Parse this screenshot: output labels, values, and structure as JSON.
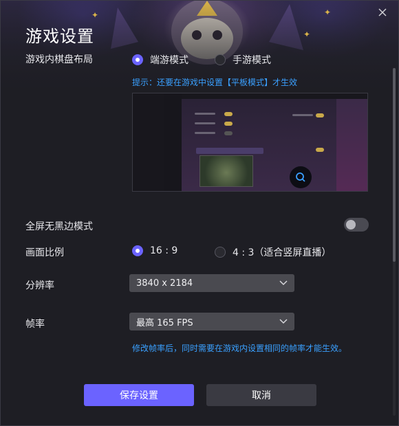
{
  "dialog": {
    "title": "游戏设置"
  },
  "layout": {
    "label": "游戏内棋盘布局",
    "option_pc": "端游模式",
    "option_mobile": "手游模式",
    "selected": "端游模式",
    "hint": "提示：还要在游戏中设置【平板模式】才生效"
  },
  "fullscreen": {
    "label": "全屏无黑边模式",
    "enabled": false
  },
  "ratio": {
    "label": "画面比例",
    "option_16_9": "16 : 9",
    "option_4_3": "4 : 3（适合竖屏直播）",
    "selected": "16 : 9"
  },
  "resolution": {
    "label": "分辨率",
    "value": "3840 x 2184"
  },
  "framerate": {
    "label": "帧率",
    "value": "最高 165 FPS",
    "hint": "修改帧率后，同时需要在游戏内设置相同的帧率才能生效。"
  },
  "buttons": {
    "save": "保存设置",
    "cancel": "取消"
  },
  "colors": {
    "accent": "#6b63ff",
    "hint": "#3aa0ff",
    "background": "#1e1e24"
  }
}
